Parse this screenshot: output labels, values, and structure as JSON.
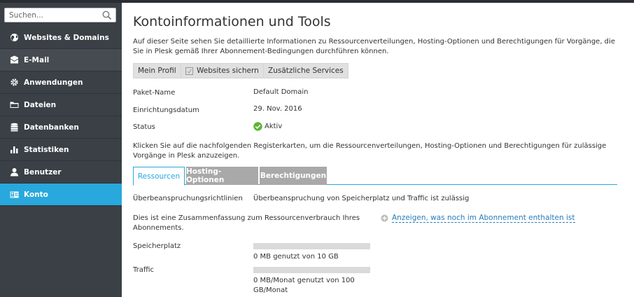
{
  "search": {
    "placeholder": "Suchen..."
  },
  "sidebar": {
    "items": [
      {
        "label": "Websites & Domains",
        "icon": "globe-icon"
      },
      {
        "label": "E-Mail",
        "icon": "envelope-icon"
      },
      {
        "label": "Anwendungen",
        "icon": "gear-icon"
      },
      {
        "label": "Dateien",
        "icon": "folder-icon"
      },
      {
        "label": "Datenbanken",
        "icon": "database-icon"
      },
      {
        "label": "Statistiken",
        "icon": "bar-chart-icon"
      },
      {
        "label": "Benutzer",
        "icon": "user-icon"
      },
      {
        "label": "Konto",
        "icon": "account-icon"
      }
    ],
    "active": "Konto"
  },
  "page": {
    "title": "Kontoinformationen und Tools",
    "intro": "Auf dieser Seite sehen Sie detaillierte Informationen zu Ressourcenverteilungen, Hosting-Optionen und Berechtigungen für Vorgänge, die Sie in Plesk gemäß Ihrer Abonnement-Bedingungen durchführen können."
  },
  "toolbar": {
    "profile_label": "Mein Profil",
    "backup_label": "Websites sichern",
    "services_label": "Zusätzliche Services"
  },
  "details": {
    "plan_label": "Paket-Name",
    "plan_value": "Default Domain",
    "date_label": "Einrichtungsdatum",
    "date_value": "29. Nov. 2016",
    "status_label": "Status",
    "status_value": "Aktiv"
  },
  "para2": "Klicken Sie auf die nachfolgenden Registerkarten, um die Ressourcenverteilungen, Hosting-Optionen und Berechtigungen für zulässige Vorgänge in Plesk anzuzeigen.",
  "tabs": [
    {
      "label": "Ressourcen",
      "active": true
    },
    {
      "label": "Hosting-Optionen",
      "active": false
    },
    {
      "label": "Berechtigungen",
      "active": false
    }
  ],
  "resources": {
    "overuse_label": "Überbeanspruchungsrichtlinien",
    "overuse_value": "Überbeanspruchung von Speicherplatz und Traffic ist zulässig",
    "summary": "Dies ist eine Zusammenfassung zum Ressourcenverbrauch Ihres Abonnements.",
    "show_more_link": "Anzeigen, was noch im Abonnement enthalten ist",
    "disk_label": "Speicherplatz",
    "disk_usage": "0 MB genutzt von 10 GB",
    "disk_fraction": 0,
    "traffic_label": "Traffic",
    "traffic_usage": "0 MB/Monat genutzt von 100 GB/Monat",
    "traffic_fraction": 0
  },
  "colors": {
    "accent": "#28a8dc",
    "sidebar": "#3a4046",
    "status_ok": "#5cb531",
    "link": "#2a7cb8"
  }
}
